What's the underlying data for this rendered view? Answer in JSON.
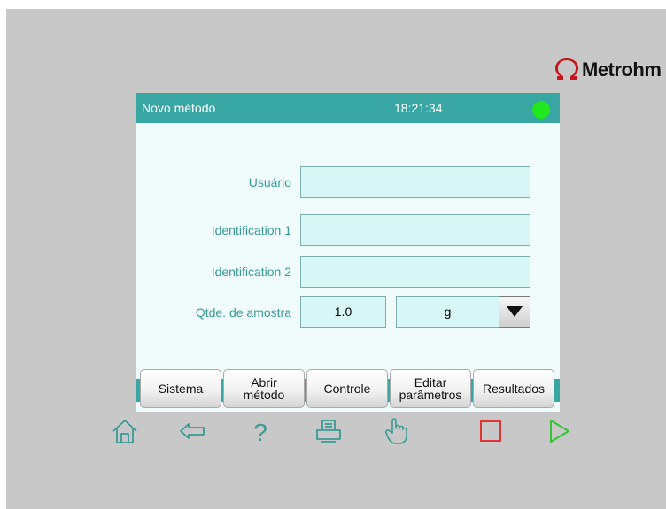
{
  "brand": {
    "name": "Metrohm"
  },
  "screen": {
    "title": "Novo método",
    "time": "18:21:34",
    "status_color": "#1fe81f"
  },
  "form": {
    "usuario": {
      "label": "Usuário",
      "value": ""
    },
    "id1": {
      "label": "Identification 1",
      "value": ""
    },
    "id2": {
      "label": "Identification 2",
      "value": ""
    },
    "qty": {
      "label": "Qtde. de amostra",
      "value": "1.0",
      "unit": "g"
    }
  },
  "softkeys": [
    {
      "lines": [
        "Sistema"
      ]
    },
    {
      "lines": [
        "Abrir",
        "método"
      ]
    },
    {
      "lines": [
        "Controle"
      ]
    },
    {
      "lines": [
        "Editar",
        "parâmetros"
      ]
    },
    {
      "lines": [
        "Resultados"
      ]
    }
  ],
  "hardware_keys": [
    {
      "icon": "home-icon"
    },
    {
      "icon": "back-arrow-icon"
    },
    {
      "icon": "help-icon",
      "glyph": "?"
    },
    {
      "icon": "print-icon"
    },
    {
      "icon": "manual-control-hand-icon"
    },
    {
      "icon": "stop-icon",
      "color": "#e03535"
    },
    {
      "icon": "start-icon",
      "color": "#35c435"
    }
  ],
  "colors": {
    "accent_teal": "#38a6a2",
    "label_teal": "#3a9a96",
    "field_bg": "#d6f7f6",
    "screen_bg": "#f0fbfb",
    "device_bg": "#c8c8c8"
  }
}
